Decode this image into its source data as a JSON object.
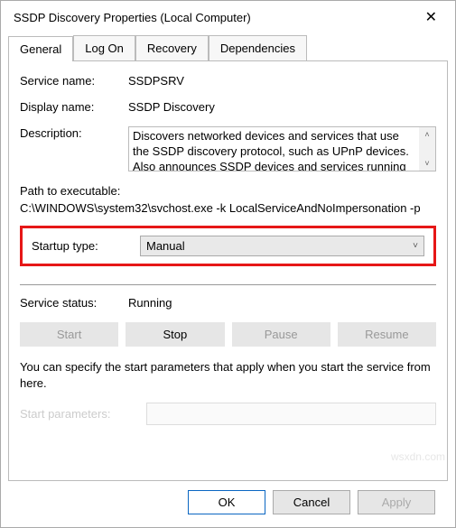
{
  "window": {
    "title": "SSDP Discovery Properties (Local Computer)"
  },
  "tabs": [
    {
      "label": "General"
    },
    {
      "label": "Log On"
    },
    {
      "label": "Recovery"
    },
    {
      "label": "Dependencies"
    }
  ],
  "fields": {
    "service_name_label": "Service name:",
    "service_name_value": "SSDPSRV",
    "display_name_label": "Display name:",
    "display_name_value": "SSDP Discovery",
    "description_label": "Description:",
    "description_value": "Discovers networked devices and services that use the SSDP discovery protocol, such as UPnP devices. Also announces SSDP devices and services running",
    "path_label": "Path to executable:",
    "path_value": "C:\\WINDOWS\\system32\\svchost.exe -k LocalServiceAndNoImpersonation -p",
    "startup_type_label": "Startup type:",
    "startup_type_value": "Manual",
    "service_status_label": "Service status:",
    "service_status_value": "Running",
    "start_params_label": "Start parameters:",
    "start_params_value": ""
  },
  "buttons": {
    "start": "Start",
    "stop": "Stop",
    "pause": "Pause",
    "resume": "Resume",
    "ok": "OK",
    "cancel": "Cancel",
    "apply": "Apply"
  },
  "note": "You can specify the start parameters that apply when you start the service from here.",
  "watermark": "wsxdn.com"
}
